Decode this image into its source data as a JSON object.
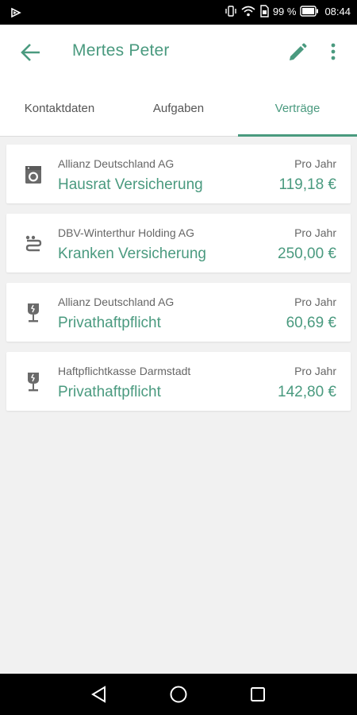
{
  "status_bar": {
    "battery_percent": "99 %",
    "time": "08:44"
  },
  "app_bar": {
    "title": "Mertes Peter",
    "icons": [
      "arrow-back-icon",
      "pencil-icon",
      "more-vert-icon"
    ]
  },
  "tabs": [
    {
      "label": "Kontaktdaten",
      "active": false
    },
    {
      "label": "Aufgaben",
      "active": false
    },
    {
      "label": "Verträge",
      "active": true
    }
  ],
  "contracts": [
    {
      "icon": "washing-machine-icon",
      "company": "Allianz Deutschland AG",
      "product": "Hausrat Versicherung",
      "period": "Pro Jahr",
      "amount": "119,18 €"
    },
    {
      "icon": "medical-icon",
      "company": "DBV-Winterthur Holding AG",
      "product": "Kranken Versicherung",
      "period": "Pro Jahr",
      "amount": "250,00 €"
    },
    {
      "icon": "fragile-glass-icon",
      "company": "Allianz Deutschland AG",
      "product": "Privathaftpflicht",
      "period": "Pro Jahr",
      "amount": "60,69 €"
    },
    {
      "icon": "fragile-glass-icon",
      "company": "Haftpflichtkasse Darmstadt",
      "product": "Privathaftpflicht",
      "period": "Pro Jahr",
      "amount": "142,80 €"
    }
  ],
  "colors": {
    "accent": "#4a9a7f",
    "background": "#f1f1f1"
  }
}
